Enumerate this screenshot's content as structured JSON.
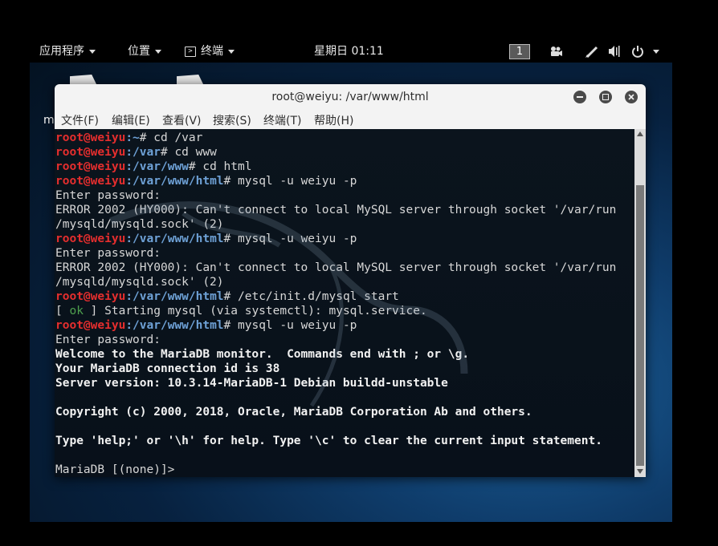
{
  "topbar": {
    "applications": "应用程序",
    "places": "位置",
    "terminal_app": "终端",
    "clock": "星期日 01:11",
    "workspace": "1",
    "icons": [
      "video-camera-icon",
      "pen-icon",
      "volume-icon",
      "power-icon",
      "chevron-down-icon"
    ]
  },
  "desktop": {
    "label_fragment": "m"
  },
  "window": {
    "title": "root@weiyu: /var/www/html",
    "controls": [
      "minimize-icon",
      "maximize-icon",
      "close-icon"
    ],
    "menu": [
      "文件(F)",
      "编辑(E)",
      "查看(V)",
      "搜索(S)",
      "终端(T)",
      "帮助(H)"
    ]
  },
  "terminal": {
    "colors": {
      "user": "#e52e2e",
      "path": "#6ea1d6",
      "ok": "#4ea04e",
      "text": "#d7d7d7"
    },
    "lines": [
      {
        "type": "prompt",
        "user": "root@weiyu",
        "path": ":~",
        "sym": "# ",
        "cmd": "cd /var"
      },
      {
        "type": "prompt",
        "user": "root@weiyu",
        "path": ":/var",
        "sym": "# ",
        "cmd": "cd www"
      },
      {
        "type": "prompt",
        "user": "root@weiyu",
        "path": ":/var/www",
        "sym": "# ",
        "cmd": "cd html"
      },
      {
        "type": "prompt",
        "user": "root@weiyu",
        "path": ":/var/www/html",
        "sym": "# ",
        "cmd": "mysql -u weiyu -p"
      },
      {
        "type": "text",
        "text": "Enter password:"
      },
      {
        "type": "text",
        "text": "ERROR 2002 (HY000): Can't connect to local MySQL server through socket '/var/run"
      },
      {
        "type": "text",
        "text": "/mysqld/mysqld.sock' (2)"
      },
      {
        "type": "prompt",
        "user": "root@weiyu",
        "path": ":/var/www/html",
        "sym": "# ",
        "cmd": "mysql -u weiyu -p"
      },
      {
        "type": "text",
        "text": "Enter password:"
      },
      {
        "type": "text",
        "text": "ERROR 2002 (HY000): Can't connect to local MySQL server through socket '/var/run"
      },
      {
        "type": "text",
        "text": "/mysqld/mysqld.sock' (2)"
      },
      {
        "type": "prompt",
        "user": "root@weiyu",
        "path": ":/var/www/html",
        "sym": "# ",
        "cmd": "/etc/init.d/mysql start"
      },
      {
        "type": "ok",
        "pre": "[ ",
        "ok": "ok",
        "post": " ] Starting mysql (via systemctl): mysql.service."
      },
      {
        "type": "prompt",
        "user": "root@weiyu",
        "path": ":/var/www/html",
        "sym": "# ",
        "cmd": "mysql -u weiyu -p"
      },
      {
        "type": "text",
        "text": "Enter password:"
      },
      {
        "type": "bold",
        "text": "Welcome to the MariaDB monitor.  Commands end with ; or \\g."
      },
      {
        "type": "bold",
        "text": "Your MariaDB connection id is 38"
      },
      {
        "type": "bold",
        "text": "Server version: 10.3.14-MariaDB-1 Debian buildd-unstable"
      },
      {
        "type": "text",
        "text": ""
      },
      {
        "type": "bold",
        "text": "Copyright (c) 2000, 2018, Oracle, MariaDB Corporation Ab and others."
      },
      {
        "type": "text",
        "text": ""
      },
      {
        "type": "bold",
        "text": "Type 'help;' or '\\h' for help. Type '\\c' to clear the current input statement."
      },
      {
        "type": "text",
        "text": ""
      },
      {
        "type": "text",
        "text": "MariaDB [(none)]> "
      }
    ]
  }
}
